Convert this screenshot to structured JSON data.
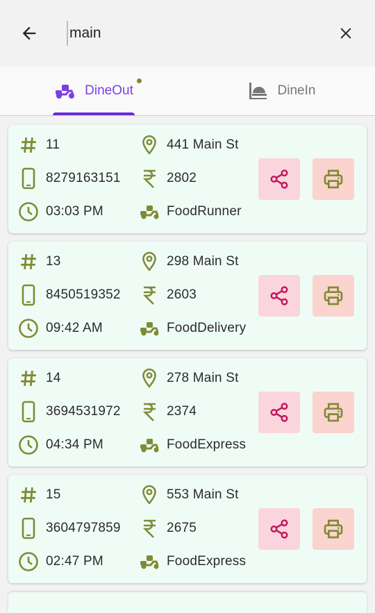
{
  "search": {
    "value": "main",
    "placeholder": ""
  },
  "tabs": [
    {
      "label": "DineOut",
      "active": true,
      "icon": "scooter-icon"
    },
    {
      "label": "DineIn",
      "active": false,
      "icon": "dine-in-icon"
    }
  ],
  "colors": {
    "accent": "#6a2bd9",
    "icon_olive": "#7f8b34",
    "card_bg": "#effcf6",
    "share_bg": "#fbd5de",
    "share_icon": "#c2185b",
    "print_bg": "#fbd3cf"
  },
  "orders": [
    {
      "id": "11",
      "address": "441 Main St",
      "phone": "8279163151",
      "amount": "2802",
      "time": "03:03 PM",
      "partner": "FoodRunner"
    },
    {
      "id": "13",
      "address": "298 Main St",
      "phone": "8450519352",
      "amount": "2603",
      "time": "09:42 AM",
      "partner": "FoodDelivery"
    },
    {
      "id": "14",
      "address": "278 Main St",
      "phone": "3694531972",
      "amount": "2374",
      "time": "04:34 PM",
      "partner": "FoodExpress"
    },
    {
      "id": "15",
      "address": "553 Main St",
      "phone": "3604797859",
      "amount": "2675",
      "time": "02:47 PM",
      "partner": "FoodExpress"
    }
  ]
}
